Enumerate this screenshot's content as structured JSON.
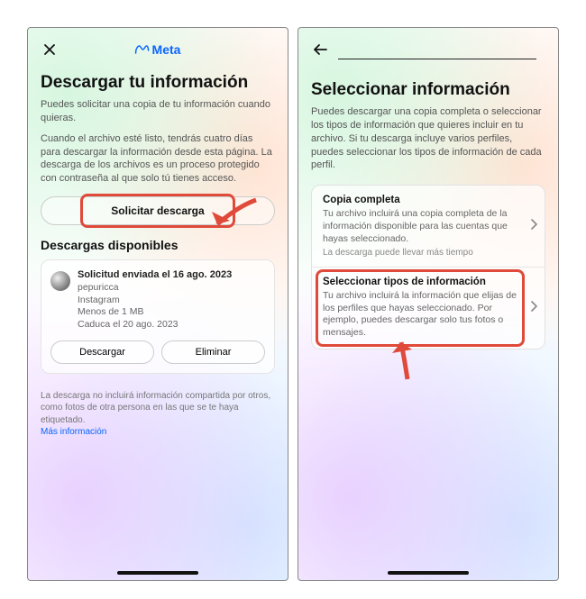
{
  "colors": {
    "accent": "#0866ff",
    "highlight": "#e04a3a"
  },
  "left": {
    "brand": "Meta",
    "title": "Descargar tu información",
    "intro1": "Puedes solicitar una copia de tu información cuando quieras.",
    "intro2": "Cuando el archivo esté listo, tendrás cuatro días para descargar la información desde esta página. La descarga de los archivos es un proceso protegido con contraseña al que solo tú tienes acceso.",
    "request_btn": "Solicitar descarga",
    "available_header": "Descargas disponibles",
    "download": {
      "title": "Solicitud enviada el 16 ago. 2023",
      "user": "pepuricca",
      "source": "Instagram",
      "size": "Menos de 1 MB",
      "expires": "Caduca el 20 ago. 2023",
      "download_btn": "Descargar",
      "delete_btn": "Eliminar"
    },
    "footnote": "La descarga no incluirá información compartida por otros, como fotos de otra persona en las que se te haya etiquetado.",
    "more_info": "Más información"
  },
  "right": {
    "title": "Seleccionar información",
    "intro": "Puedes descargar una copia completa o seleccionar los tipos de información que quieres incluir en tu archivo. Si tu descarga incluye varios perfiles, puedes seleccionar los tipos de información de cada perfil.",
    "options": [
      {
        "title": "Copia completa",
        "desc": "Tu archivo incluirá una copia completa de la información disponible para las cuentas que hayas seleccionado.",
        "note": "La descarga puede llevar más tiempo"
      },
      {
        "title": "Seleccionar tipos de información",
        "desc": "Tu archivo incluirá la información que elijas de los perfiles que hayas seleccionado. Por ejemplo, puedes descargar solo tus fotos o mensajes."
      }
    ]
  }
}
